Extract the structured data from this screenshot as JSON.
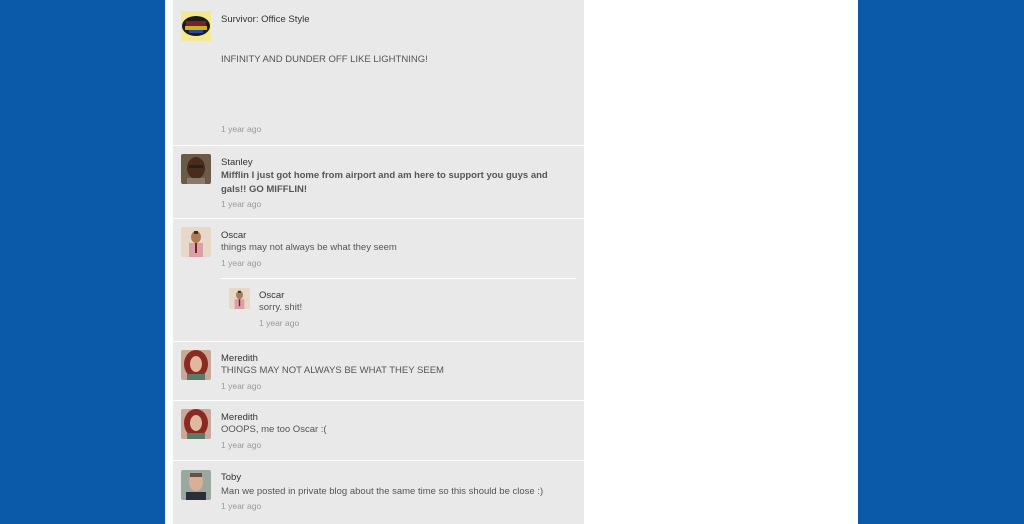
{
  "posts": [
    {
      "author": "Survivor: Office Style",
      "message": "INFINITY AND DUNDER OFF LIKE LIGHTNING!",
      "time": "1 year ago"
    },
    {
      "author": "Stanley",
      "message": "Mifflin I just got home from airport and am here to support you guys and gals!!  GO MIFFLIN!",
      "time": "1 year ago"
    },
    {
      "author": "Oscar",
      "message": "things may not always be what they seem",
      "time": "1 year ago"
    },
    {
      "author": "Meredith",
      "message": "THINGS MAY NOT ALWAYS BE WHAT THEY SEEM",
      "time": "1 year ago"
    },
    {
      "author": "Meredith",
      "message": "OOOPS, me too Oscar  :(",
      "time": "1 year ago"
    },
    {
      "author": "Toby",
      "message": "Man we posted in private blog about the same time so this should be close  :)",
      "time": "1 year ago"
    }
  ],
  "reply": {
    "author": "Oscar",
    "message": "sorry. shit!",
    "time": "1 year ago"
  },
  "colors": {
    "background": "#0b5aa9",
    "feed": "#e9e9e9"
  }
}
